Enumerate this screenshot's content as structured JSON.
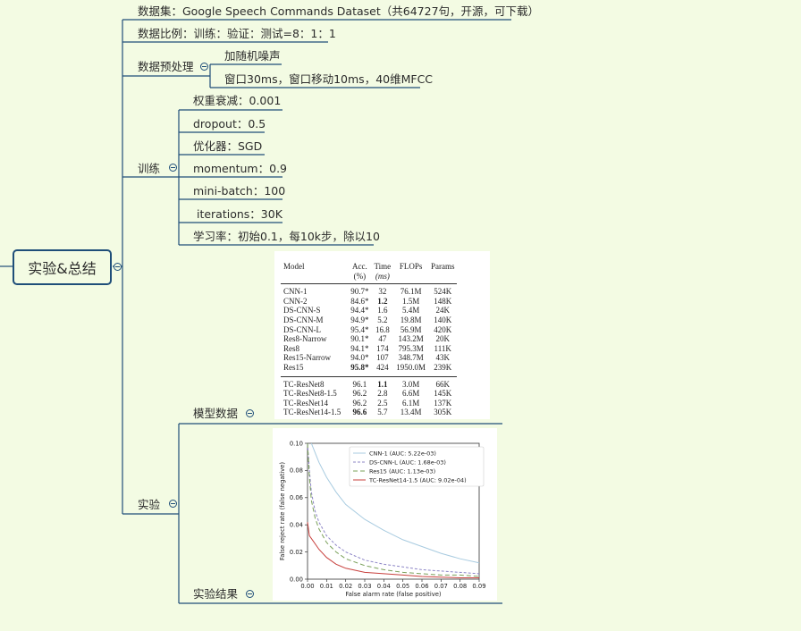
{
  "root": {
    "label": "实验&总结"
  },
  "branches": {
    "dataset": "数据集：Google Speech Commands Dataset（共64727句，开源，可下载）",
    "split": "数据比例：训练：验证：测试=8：1：1",
    "preprocess": {
      "label": "数据预处理",
      "children": [
        "加随机噪声",
        "窗口30ms，窗口移动10ms，40维MFCC"
      ]
    },
    "training": {
      "label": "训练",
      "children": [
        "权重衰减：0.001",
        "dropout：0.5",
        "优化器：SGD",
        "momentum：0.9",
        "mini-batch：100",
        " iterations：30K",
        "学习率：初始0.1，每10k步，除以10"
      ]
    },
    "experiment": {
      "label": "实验",
      "model_data": "模型数据",
      "results": "实验结果"
    }
  },
  "table": {
    "headers": [
      "Model",
      "Acc.\n(%)",
      "Time\n(ms)",
      "FLOPs",
      "Params"
    ],
    "rows_a": [
      [
        "CNN-1",
        "90.7*",
        "32",
        "76.1M",
        "524K"
      ],
      [
        "CNN-2",
        "84.6*",
        "1.2",
        "1.5M",
        "148K"
      ],
      [
        "DS-CNN-S",
        "94.4*",
        "1.6",
        "5.4M",
        "24K"
      ],
      [
        "DS-CNN-M",
        "94.9*",
        "5.2",
        "19.8M",
        "140K"
      ],
      [
        "DS-CNN-L",
        "95.4*",
        "16.8",
        "56.9M",
        "420K"
      ],
      [
        "Res8-Narrow",
        "90.1*",
        "47",
        "143.2M",
        "20K"
      ],
      [
        "Res8",
        "94.1*",
        "174",
        "795.3M",
        "111K"
      ],
      [
        "Res15-Narrow",
        "94.0*",
        "107",
        "348.7M",
        "43K"
      ],
      [
        "Res15",
        "95.8*",
        "424",
        "1950.0M",
        "239K"
      ]
    ],
    "rows_b": [
      [
        "TC-ResNet8",
        "96.1",
        "1.1",
        "3.0M",
        "66K"
      ],
      [
        "TC-ResNet8-1.5",
        "96.2",
        "2.8",
        "6.6M",
        "145K"
      ],
      [
        "TC-ResNet14",
        "96.2",
        "2.5",
        "6.1M",
        "137K"
      ],
      [
        "TC-ResNet14-1.5",
        "96.6",
        "5.7",
        "13.4M",
        "305K"
      ]
    ]
  },
  "chart_data": {
    "type": "line",
    "xlabel": "False alarm rate (false positive)",
    "ylabel": "False reject rate (false negative)",
    "xlim": [
      0,
      0.09
    ],
    "ylim": [
      0,
      0.1
    ],
    "xticks": [
      "0.00",
      "0.01",
      "0.02",
      "0.03",
      "0.04",
      "0.05",
      "0.06",
      "0.07",
      "0.08",
      "0.09"
    ],
    "yticks": [
      "0.00",
      "0.02",
      "0.04",
      "0.06",
      "0.08",
      "0.10"
    ],
    "legend_position": "top-right",
    "series": [
      {
        "name": "CNN-1 (AUC: 5.22e-03)",
        "color": "#a8cbe0",
        "dash": "",
        "x": [
          0.002,
          0.004,
          0.006,
          0.01,
          0.015,
          0.02,
          0.03,
          0.04,
          0.05,
          0.06,
          0.07,
          0.08,
          0.09
        ],
        "y": [
          0.1,
          0.093,
          0.086,
          0.075,
          0.064,
          0.055,
          0.044,
          0.036,
          0.029,
          0.024,
          0.019,
          0.015,
          0.012
        ]
      },
      {
        "name": "DS-CNN-L (AUC: 1.68e-03)",
        "color": "#8c84c6",
        "dash": "3,2",
        "x": [
          0.0,
          0.001,
          0.002,
          0.004,
          0.006,
          0.01,
          0.015,
          0.02,
          0.03,
          0.04,
          0.05,
          0.06,
          0.07,
          0.08,
          0.09
        ],
        "y": [
          0.1,
          0.08,
          0.064,
          0.05,
          0.042,
          0.032,
          0.025,
          0.02,
          0.014,
          0.011,
          0.009,
          0.007,
          0.006,
          0.005,
          0.004
        ]
      },
      {
        "name": "Res15 (AUC: 1.13e-03)",
        "color": "#7aa05a",
        "dash": "5,3",
        "x": [
          0.0,
          0.001,
          0.002,
          0.004,
          0.006,
          0.01,
          0.015,
          0.02,
          0.03,
          0.04,
          0.05,
          0.06,
          0.07,
          0.08,
          0.09
        ],
        "y": [
          0.1,
          0.075,
          0.058,
          0.045,
          0.037,
          0.027,
          0.02,
          0.015,
          0.01,
          0.007,
          0.005,
          0.004,
          0.003,
          0.003,
          0.002
        ]
      },
      {
        "name": "TC-ResNet14-1.5 (AUC: 9.02e-04)",
        "color": "#c8413e",
        "dash": "",
        "x": [
          0.0,
          0.001,
          0.003,
          0.006,
          0.01,
          0.015,
          0.02,
          0.03,
          0.04,
          0.05,
          0.06,
          0.07,
          0.08,
          0.09
        ],
        "y": [
          0.042,
          0.032,
          0.028,
          0.022,
          0.016,
          0.011,
          0.008,
          0.005,
          0.004,
          0.003,
          0.002,
          0.0015,
          0.001,
          0.001
        ]
      }
    ]
  },
  "colors": {
    "background": "#f3fbe3",
    "line": "#1f4e79"
  }
}
